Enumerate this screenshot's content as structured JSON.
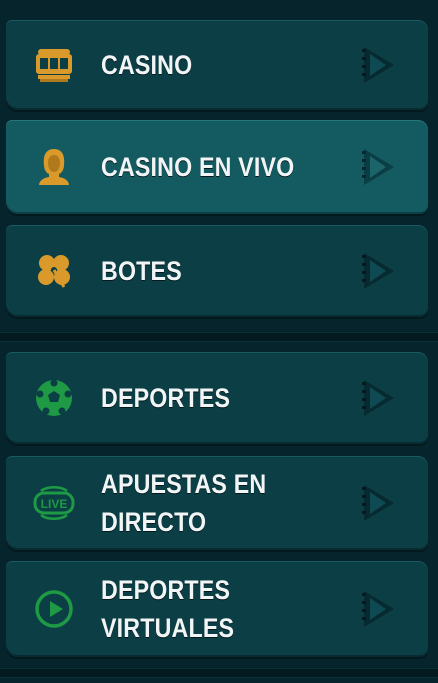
{
  "colors": {
    "background": "#06242b",
    "item_bg": "#0b3e45",
    "item_active_bg": "#145b61",
    "gold": "#d99a2b",
    "green": "#1e9a45",
    "arrow": "#04262b",
    "label": "#f2f5f5"
  },
  "menu": {
    "casino_group": [
      {
        "label": "CASINO",
        "icon": "slot-machine-icon"
      },
      {
        "label": "CASINO EN VIVO",
        "icon": "live-dealer-icon"
      },
      {
        "label": "BOTES",
        "icon": "clover-icon"
      }
    ],
    "sports_group": [
      {
        "label": "DEPORTES",
        "icon": "soccer-ball-icon"
      },
      {
        "label": "APUESTAS EN DIRECTO",
        "icon": "live-badge-icon",
        "badge_text": "LIVE"
      },
      {
        "label": "DEPORTES VIRTUALES",
        "icon": "play-circle-icon"
      }
    ],
    "active_item": "CASINO EN VIVO"
  }
}
